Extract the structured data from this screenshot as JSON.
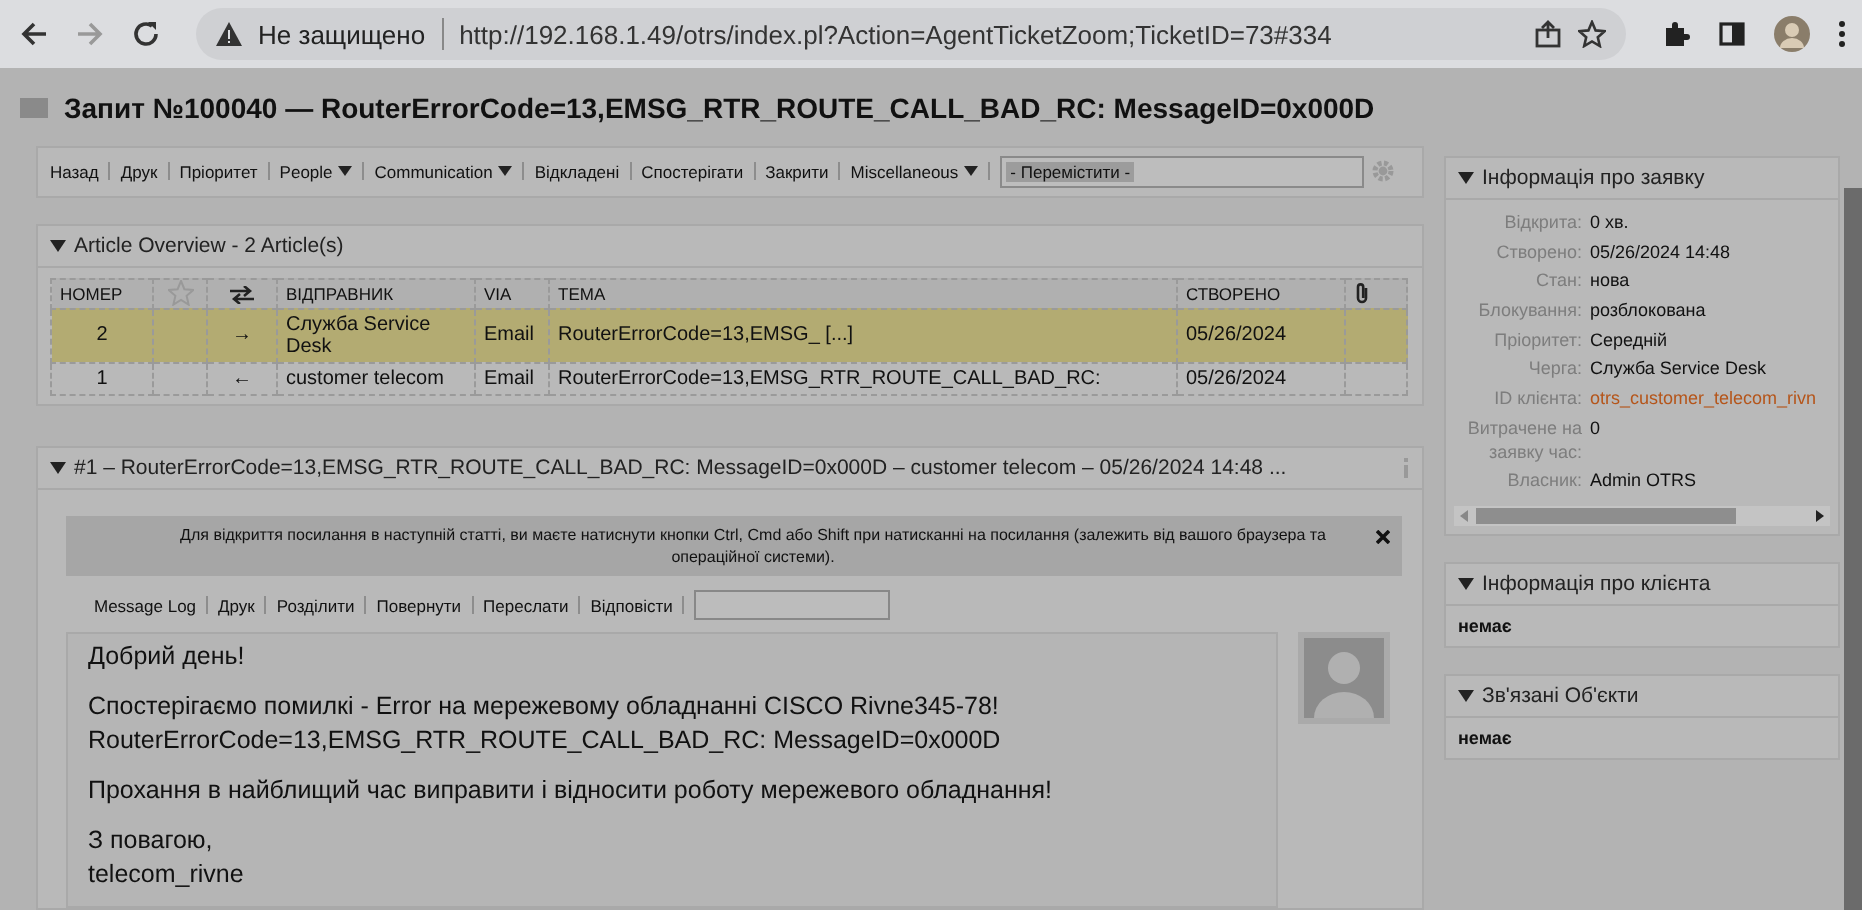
{
  "browser": {
    "security": "Не защищено",
    "url": "http://192.168.1.49/otrs/index.pl?Action=AgentTicketZoom;TicketID=73#334"
  },
  "page_title": "Запит №100040 — RouterErrorCode=13,EMSG_RTR_ROUTE_CALL_BAD_RC: MessageID=0x000D",
  "toolbar": {
    "items": [
      {
        "label": "Назад",
        "dropdown": false
      },
      {
        "label": "Друк",
        "dropdown": false
      },
      {
        "label": "Пріоритет",
        "dropdown": false
      },
      {
        "label": "People",
        "dropdown": true
      },
      {
        "label": "Communication",
        "dropdown": true
      },
      {
        "label": "Відкладені",
        "dropdown": false
      },
      {
        "label": "Спостерігати",
        "dropdown": false
      },
      {
        "label": "Закрити",
        "dropdown": false
      },
      {
        "label": "Miscellaneous",
        "dropdown": true
      }
    ],
    "move_select": "- Перемістити -"
  },
  "article_overview": {
    "title": "Article Overview - 2 Article(s)",
    "columns": [
      {
        "kind": "text",
        "label": "НОМЕР"
      },
      {
        "kind": "star"
      },
      {
        "kind": "direction"
      },
      {
        "kind": "text",
        "label": "ВІДПРАВНИК"
      },
      {
        "kind": "text",
        "label": "VIA"
      },
      {
        "kind": "text",
        "label": "ТЕМА"
      },
      {
        "kind": "text",
        "label": "СТВОРЕНО"
      },
      {
        "kind": "attachment"
      }
    ],
    "rows": [
      {
        "number": "2",
        "arrow": "→",
        "sender": "Служба Service Desk",
        "via": "Email",
        "subject": "RouterErrorCode=13,EMSG_ [...]",
        "created": "05/26/2024",
        "selected": true
      },
      {
        "number": "1",
        "arrow": "←",
        "sender": "customer telecom",
        "via": "Email",
        "subject": "RouterErrorCode=13,EMSG_RTR_ROUTE_CALL_BAD_RC:",
        "created": "05/26/2024",
        "selected": false
      }
    ]
  },
  "article": {
    "header": "#1 – RouterErrorCode=13,EMSG_RTR_ROUTE_CALL_BAD_RC: MessageID=0x000D – customer telecom – 05/26/2024 14:48 ...",
    "notice": "Для відкриття посилання в наступній статті, ви маєте натиснути кнопки Ctrl, Cmd або Shift при натисканні на посилання (залежить від вашого браузера та операційної системи).",
    "actions": [
      "Message Log",
      "Друк",
      "Розділити",
      "Повернути",
      "Переслати",
      "Відповісти"
    ],
    "body": [
      "Добрий день!",
      "Спостерігаємо помилкі - Error на мережевому обладнанні CISCO Rivne345-78!\nRouterErrorCode=13,EMSG_RTR_ROUTE_CALL_BAD_RC: MessageID=0x000D",
      "Прохання в найблищий час виправити і відносити роботу мережевого обладнання!",
      "З повагою,\ntelecom_rivne"
    ]
  },
  "sidebar": [
    {
      "kind": "fields",
      "title": "Інформація про заявку",
      "fields": [
        {
          "label": "Відкрита:",
          "value": "0 хв.",
          "kind": "text"
        },
        {
          "label": "Створено:",
          "value": "05/26/2024 14:48",
          "kind": "text"
        },
        {
          "label": "Стан:",
          "value": "нова",
          "kind": "text"
        },
        {
          "label": "Блокування:",
          "value": "розблокована",
          "kind": "text"
        },
        {
          "label": "Пріоритет:",
          "value": "Середній",
          "kind": "text"
        },
        {
          "label": "Черга:",
          "value": "Служба Service Desk",
          "kind": "text"
        },
        {
          "label": "ID клієнта:",
          "value": "otrs_customer_telecom_rivn",
          "kind": "link"
        },
        {
          "label": "Витрачене на заявку час:",
          "value": "0",
          "kind": "text"
        },
        {
          "label": "Власник:",
          "value": "Admin OTRS",
          "kind": "text"
        }
      ]
    },
    {
      "kind": "text",
      "title": "Інформація про клієнта",
      "text": "немає"
    },
    {
      "kind": "text",
      "title": "Зв'язані Об'єкти",
      "text": "немає"
    }
  ]
}
